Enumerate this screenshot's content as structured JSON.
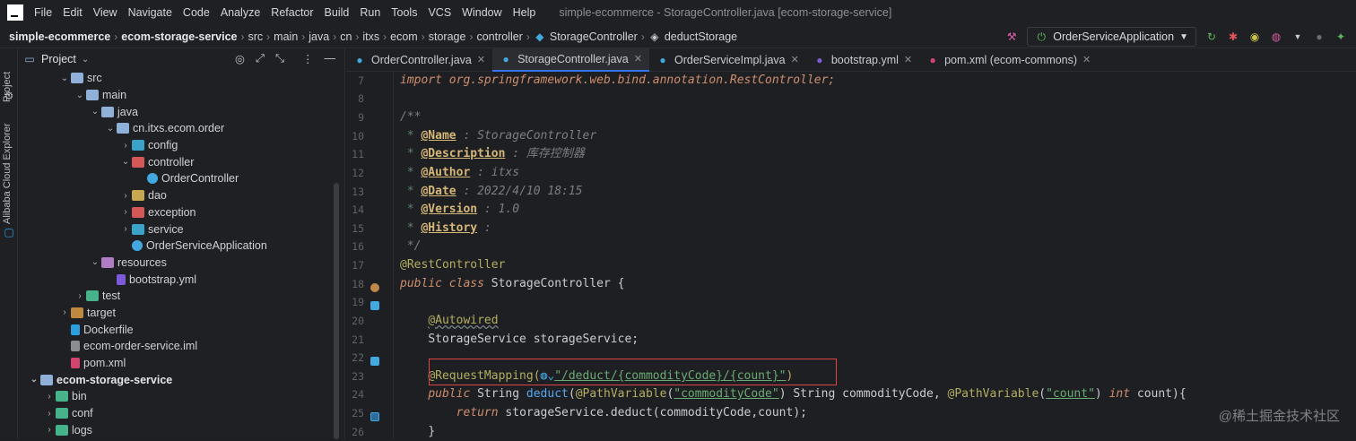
{
  "menu": {
    "items": [
      "File",
      "Edit",
      "View",
      "Navigate",
      "Code",
      "Analyze",
      "Refactor",
      "Build",
      "Run",
      "Tools",
      "VCS",
      "Window",
      "Help"
    ],
    "window_title": "simple-ecommerce - StorageController.java [ecom-storage-service]"
  },
  "breadcrumb": [
    "simple-ecommerce",
    "ecom-storage-service",
    "src",
    "main",
    "java",
    "cn",
    "itxs",
    "ecom",
    "storage",
    "controller",
    "StorageController",
    "deductStorage"
  ],
  "run_config": {
    "label": "OrderServiceApplication"
  },
  "side": {
    "project_label": "Project",
    "cloud_label": "Alibaba Cloud Explorer"
  },
  "project": {
    "title": "Project",
    "tree": [
      {
        "label": "src",
        "depth": 3,
        "arrow": "v",
        "icon": "folder",
        "color": "#8fb0d8"
      },
      {
        "label": "main",
        "depth": 4,
        "arrow": "v",
        "icon": "folder",
        "color": "#8fb0d8"
      },
      {
        "label": "java",
        "depth": 5,
        "arrow": "v",
        "icon": "folder",
        "color": "#8fb0d8"
      },
      {
        "label": "cn.itxs.ecom.order",
        "depth": 6,
        "arrow": "v",
        "icon": "folder",
        "color": "#8fb0d8"
      },
      {
        "label": "config",
        "depth": 7,
        "arrow": ">",
        "icon": "folder",
        "color": "#3aa3c9"
      },
      {
        "label": "controller",
        "depth": 7,
        "arrow": "v",
        "icon": "folder",
        "color": "#d45858"
      },
      {
        "label": "OrderController",
        "depth": 8,
        "arrow": "",
        "icon": "class",
        "color": "#43a8e0"
      },
      {
        "label": "dao",
        "depth": 7,
        "arrow": ">",
        "icon": "folder",
        "color": "#c8a94f"
      },
      {
        "label": "exception",
        "depth": 7,
        "arrow": ">",
        "icon": "folder",
        "color": "#d45858"
      },
      {
        "label": "service",
        "depth": 7,
        "arrow": ">",
        "icon": "folder",
        "color": "#3aa3c9"
      },
      {
        "label": "OrderServiceApplication",
        "depth": 7,
        "arrow": "",
        "icon": "class",
        "color": "#43a8e0"
      },
      {
        "label": "resources",
        "depth": 5,
        "arrow": "v",
        "icon": "folder",
        "color": "#b07cc6"
      },
      {
        "label": "bootstrap.yml",
        "depth": 6,
        "arrow": "",
        "icon": "file",
        "color": "#7c5cd6"
      },
      {
        "label": "test",
        "depth": 4,
        "arrow": ">",
        "icon": "folder",
        "color": "#46b38a"
      },
      {
        "label": "target",
        "depth": 3,
        "arrow": ">",
        "icon": "folder",
        "color": "#c0883e"
      },
      {
        "label": "Dockerfile",
        "depth": 3,
        "arrow": "",
        "icon": "file",
        "color": "#2aa0e0"
      },
      {
        "label": "ecom-order-service.iml",
        "depth": 3,
        "arrow": "",
        "icon": "file",
        "color": "#8a8d92"
      },
      {
        "label": "pom.xml",
        "depth": 3,
        "arrow": "",
        "icon": "file",
        "color": "#d4446e"
      },
      {
        "label": "ecom-storage-service",
        "depth": 1,
        "arrow": "v",
        "icon": "folder",
        "color": "#8fb0d8",
        "bold": true
      },
      {
        "label": "bin",
        "depth": 2,
        "arrow": ">",
        "icon": "folder",
        "color": "#46b38a"
      },
      {
        "label": "conf",
        "depth": 2,
        "arrow": ">",
        "icon": "folder",
        "color": "#46b38a"
      },
      {
        "label": "logs",
        "depth": 2,
        "arrow": ">",
        "icon": "folder",
        "color": "#46b38a"
      }
    ]
  },
  "tabs": [
    {
      "label": "OrderController.java",
      "active": false,
      "color": "#43a8e0"
    },
    {
      "label": "StorageController.java",
      "active": true,
      "color": "#43a8e0"
    },
    {
      "label": "OrderServiceImpl.java",
      "active": false,
      "color": "#43a8e0"
    },
    {
      "label": "bootstrap.yml",
      "active": false,
      "color": "#7c5cd6"
    },
    {
      "label": "pom.xml (ecom-commons)",
      "active": false,
      "color": "#d4446e"
    }
  ],
  "code": {
    "lines": [
      "7",
      "8",
      "9",
      "10",
      "11",
      "12",
      "13",
      "14",
      "15",
      "16",
      "17",
      "18",
      "19",
      "20",
      "21",
      "22",
      "23",
      "24",
      "25",
      "26"
    ],
    "l7_kw": "import",
    "l7_rest": " org.springframework.web.bind.annotation.RestController;",
    "l9": "/**",
    "name_tag": "@Name",
    "name_val": " : StorageController",
    "desc_tag": "@Description",
    "desc_val": " : 库存控制器",
    "author_tag": "@Author",
    "author_val": " : itxs",
    "date_tag": "@Date",
    "date_val": " : 2022/4/10 18:15",
    "ver_tag": "@Version",
    "ver_val": " : 1.0",
    "hist_tag": "@History",
    "hist_val": " :",
    "l16": " */",
    "l17": "@RestController",
    "l18_kw": "public class",
    "l18_rest": " StorageController {",
    "l20": "@Autowired",
    "l21": "StorageService storageService;",
    "l23_ann": "@RequestMapping(",
    "l23_str": "\"/deduct/{commodityCode}/{count}\"",
    "l23_end": ")",
    "l24_kw": "public",
    "l24_a": " String ",
    "l24_fn": "deduct",
    "l24_b": "(",
    "l24_ann1": "@PathVariable",
    "l24_c": "(",
    "l24_s1": "\"commodityCode\"",
    "l24_d": ") String commodityCode, ",
    "l24_ann2": "@PathVariable",
    "l24_e": "(",
    "l24_s2": "\"count\"",
    "l24_f": ") ",
    "l24_kw2": "int",
    "l24_g": " count){",
    "l25_kw": "return",
    "l25_rest": " storageService.deduct(commodityCode,count);",
    "l26": "}"
  },
  "watermark": "@稀土掘金技术社区"
}
